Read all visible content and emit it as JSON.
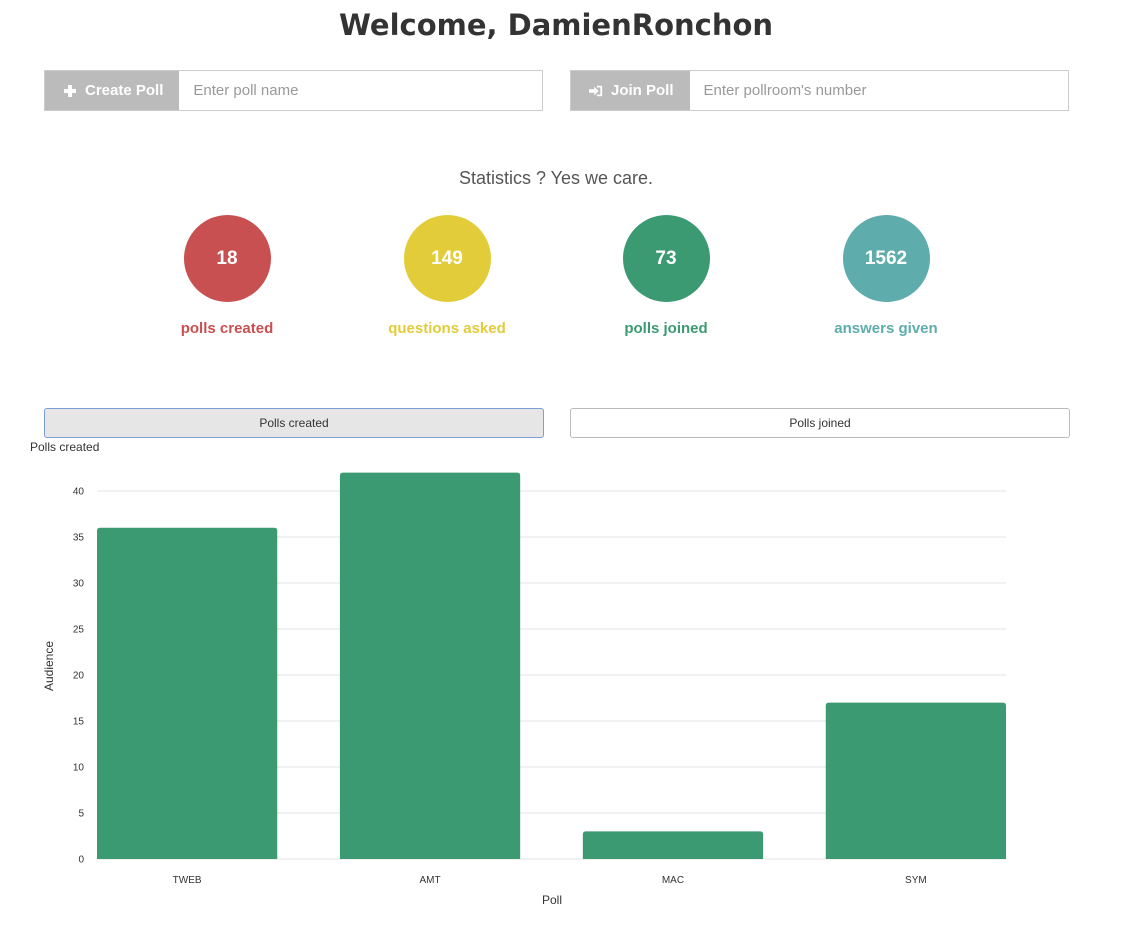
{
  "header": {
    "title": "Welcome, DamienRonchon"
  },
  "create_poll": {
    "label": "Create Poll",
    "placeholder": "Enter poll name"
  },
  "join_poll": {
    "label": "Join Poll",
    "placeholder": "Enter pollroom's number"
  },
  "statistics": {
    "heading": "Statistics ? Yes we care.",
    "items": [
      {
        "value": "18",
        "label": "polls created",
        "color": "#c85050"
      },
      {
        "value": "149",
        "label": "questions asked",
        "color": "#e2cc3a"
      },
      {
        "value": "73",
        "label": "polls joined",
        "color": "#3c9a72"
      },
      {
        "value": "1562",
        "label": "answers given",
        "color": "#5eacac"
      }
    ]
  },
  "tabs": {
    "polls_created": "Polls created",
    "polls_joined": "Polls joined",
    "active": "polls_created"
  },
  "chart_data": {
    "type": "bar",
    "title": "Polls created",
    "categories": [
      "TWEB",
      "AMT",
      "MAC",
      "SYM"
    ],
    "values": [
      36,
      42,
      3,
      17
    ],
    "xlabel": "Poll",
    "ylabel": "Audience",
    "ylim": [
      0,
      40
    ],
    "yticks": [
      0,
      5,
      10,
      15,
      20,
      25,
      30,
      35,
      40
    ],
    "grid": true,
    "bar_color": "#3c9a72"
  }
}
